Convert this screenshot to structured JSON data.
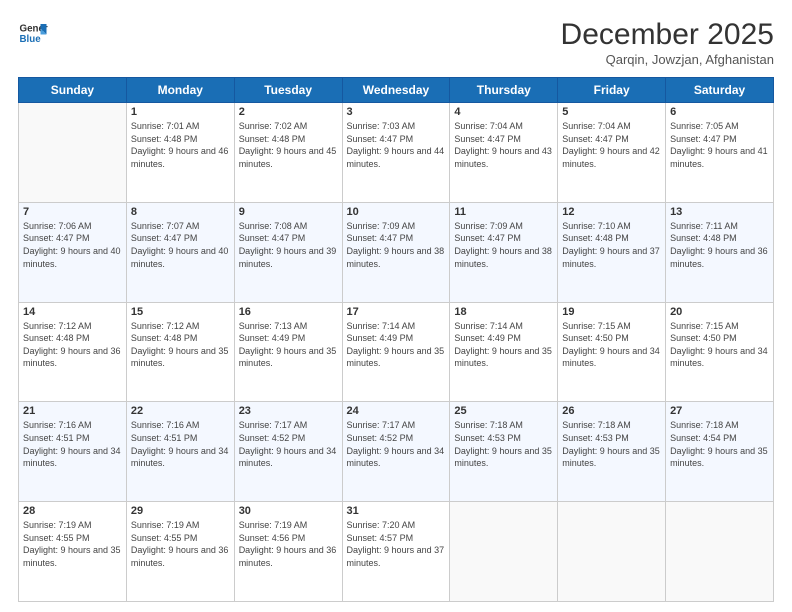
{
  "header": {
    "logo_line1": "General",
    "logo_line2": "Blue",
    "month": "December 2025",
    "location": "Qarqin, Jowzjan, Afghanistan"
  },
  "weekdays": [
    "Sunday",
    "Monday",
    "Tuesday",
    "Wednesday",
    "Thursday",
    "Friday",
    "Saturday"
  ],
  "weeks": [
    [
      {
        "day": "",
        "sunrise": "",
        "sunset": "",
        "daylight": ""
      },
      {
        "day": "1",
        "sunrise": "Sunrise: 7:01 AM",
        "sunset": "Sunset: 4:48 PM",
        "daylight": "Daylight: 9 hours and 46 minutes."
      },
      {
        "day": "2",
        "sunrise": "Sunrise: 7:02 AM",
        "sunset": "Sunset: 4:48 PM",
        "daylight": "Daylight: 9 hours and 45 minutes."
      },
      {
        "day": "3",
        "sunrise": "Sunrise: 7:03 AM",
        "sunset": "Sunset: 4:47 PM",
        "daylight": "Daylight: 9 hours and 44 minutes."
      },
      {
        "day": "4",
        "sunrise": "Sunrise: 7:04 AM",
        "sunset": "Sunset: 4:47 PM",
        "daylight": "Daylight: 9 hours and 43 minutes."
      },
      {
        "day": "5",
        "sunrise": "Sunrise: 7:04 AM",
        "sunset": "Sunset: 4:47 PM",
        "daylight": "Daylight: 9 hours and 42 minutes."
      },
      {
        "day": "6",
        "sunrise": "Sunrise: 7:05 AM",
        "sunset": "Sunset: 4:47 PM",
        "daylight": "Daylight: 9 hours and 41 minutes."
      }
    ],
    [
      {
        "day": "7",
        "sunrise": "Sunrise: 7:06 AM",
        "sunset": "Sunset: 4:47 PM",
        "daylight": "Daylight: 9 hours and 40 minutes."
      },
      {
        "day": "8",
        "sunrise": "Sunrise: 7:07 AM",
        "sunset": "Sunset: 4:47 PM",
        "daylight": "Daylight: 9 hours and 40 minutes."
      },
      {
        "day": "9",
        "sunrise": "Sunrise: 7:08 AM",
        "sunset": "Sunset: 4:47 PM",
        "daylight": "Daylight: 9 hours and 39 minutes."
      },
      {
        "day": "10",
        "sunrise": "Sunrise: 7:09 AM",
        "sunset": "Sunset: 4:47 PM",
        "daylight": "Daylight: 9 hours and 38 minutes."
      },
      {
        "day": "11",
        "sunrise": "Sunrise: 7:09 AM",
        "sunset": "Sunset: 4:47 PM",
        "daylight": "Daylight: 9 hours and 38 minutes."
      },
      {
        "day": "12",
        "sunrise": "Sunrise: 7:10 AM",
        "sunset": "Sunset: 4:48 PM",
        "daylight": "Daylight: 9 hours and 37 minutes."
      },
      {
        "day": "13",
        "sunrise": "Sunrise: 7:11 AM",
        "sunset": "Sunset: 4:48 PM",
        "daylight": "Daylight: 9 hours and 36 minutes."
      }
    ],
    [
      {
        "day": "14",
        "sunrise": "Sunrise: 7:12 AM",
        "sunset": "Sunset: 4:48 PM",
        "daylight": "Daylight: 9 hours and 36 minutes."
      },
      {
        "day": "15",
        "sunrise": "Sunrise: 7:12 AM",
        "sunset": "Sunset: 4:48 PM",
        "daylight": "Daylight: 9 hours and 35 minutes."
      },
      {
        "day": "16",
        "sunrise": "Sunrise: 7:13 AM",
        "sunset": "Sunset: 4:49 PM",
        "daylight": "Daylight: 9 hours and 35 minutes."
      },
      {
        "day": "17",
        "sunrise": "Sunrise: 7:14 AM",
        "sunset": "Sunset: 4:49 PM",
        "daylight": "Daylight: 9 hours and 35 minutes."
      },
      {
        "day": "18",
        "sunrise": "Sunrise: 7:14 AM",
        "sunset": "Sunset: 4:49 PM",
        "daylight": "Daylight: 9 hours and 35 minutes."
      },
      {
        "day": "19",
        "sunrise": "Sunrise: 7:15 AM",
        "sunset": "Sunset: 4:50 PM",
        "daylight": "Daylight: 9 hours and 34 minutes."
      },
      {
        "day": "20",
        "sunrise": "Sunrise: 7:15 AM",
        "sunset": "Sunset: 4:50 PM",
        "daylight": "Daylight: 9 hours and 34 minutes."
      }
    ],
    [
      {
        "day": "21",
        "sunrise": "Sunrise: 7:16 AM",
        "sunset": "Sunset: 4:51 PM",
        "daylight": "Daylight: 9 hours and 34 minutes."
      },
      {
        "day": "22",
        "sunrise": "Sunrise: 7:16 AM",
        "sunset": "Sunset: 4:51 PM",
        "daylight": "Daylight: 9 hours and 34 minutes."
      },
      {
        "day": "23",
        "sunrise": "Sunrise: 7:17 AM",
        "sunset": "Sunset: 4:52 PM",
        "daylight": "Daylight: 9 hours and 34 minutes."
      },
      {
        "day": "24",
        "sunrise": "Sunrise: 7:17 AM",
        "sunset": "Sunset: 4:52 PM",
        "daylight": "Daylight: 9 hours and 34 minutes."
      },
      {
        "day": "25",
        "sunrise": "Sunrise: 7:18 AM",
        "sunset": "Sunset: 4:53 PM",
        "daylight": "Daylight: 9 hours and 35 minutes."
      },
      {
        "day": "26",
        "sunrise": "Sunrise: 7:18 AM",
        "sunset": "Sunset: 4:53 PM",
        "daylight": "Daylight: 9 hours and 35 minutes."
      },
      {
        "day": "27",
        "sunrise": "Sunrise: 7:18 AM",
        "sunset": "Sunset: 4:54 PM",
        "daylight": "Daylight: 9 hours and 35 minutes."
      }
    ],
    [
      {
        "day": "28",
        "sunrise": "Sunrise: 7:19 AM",
        "sunset": "Sunset: 4:55 PM",
        "daylight": "Daylight: 9 hours and 35 minutes."
      },
      {
        "day": "29",
        "sunrise": "Sunrise: 7:19 AM",
        "sunset": "Sunset: 4:55 PM",
        "daylight": "Daylight: 9 hours and 36 minutes."
      },
      {
        "day": "30",
        "sunrise": "Sunrise: 7:19 AM",
        "sunset": "Sunset: 4:56 PM",
        "daylight": "Daylight: 9 hours and 36 minutes."
      },
      {
        "day": "31",
        "sunrise": "Sunrise: 7:20 AM",
        "sunset": "Sunset: 4:57 PM",
        "daylight": "Daylight: 9 hours and 37 minutes."
      },
      {
        "day": "",
        "sunrise": "",
        "sunset": "",
        "daylight": ""
      },
      {
        "day": "",
        "sunrise": "",
        "sunset": "",
        "daylight": ""
      },
      {
        "day": "",
        "sunrise": "",
        "sunset": "",
        "daylight": ""
      }
    ]
  ]
}
